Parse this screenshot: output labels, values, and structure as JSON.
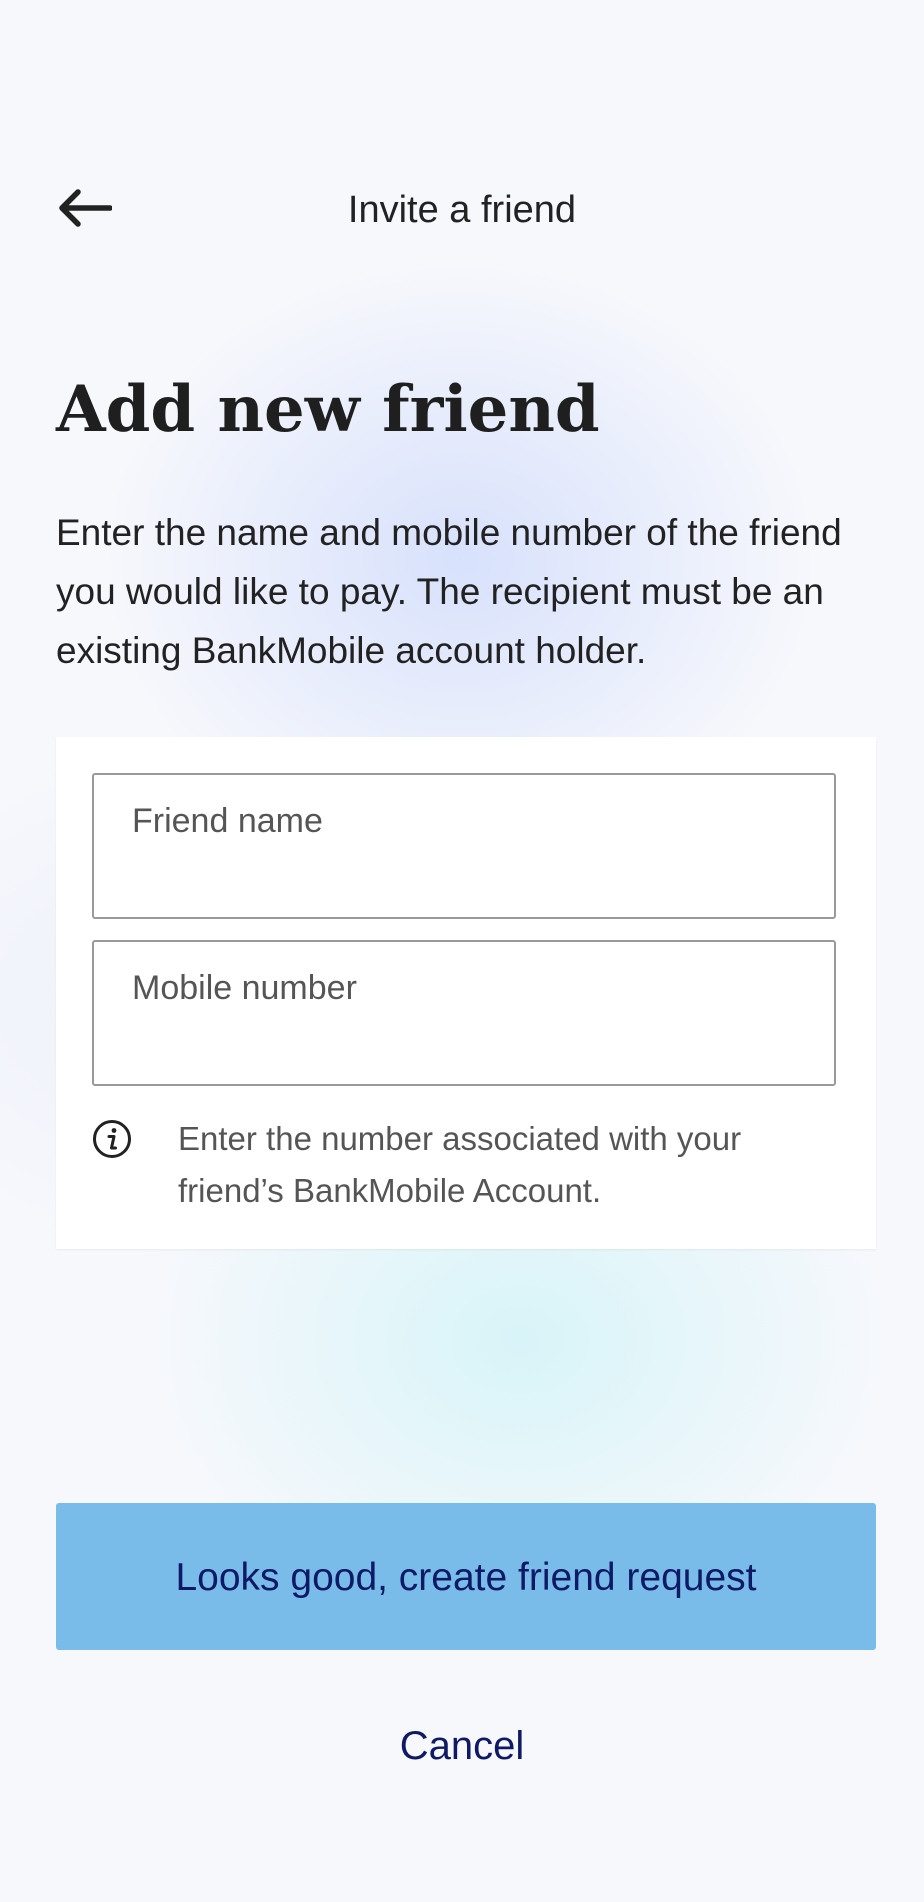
{
  "header": {
    "title": "Invite a friend",
    "back_icon": "arrow-left-icon"
  },
  "main": {
    "heading": "Add new friend",
    "description": "Enter the name and mobile number of the friend you would like to pay. The recipient must be an existing BankMobile account holder.",
    "form": {
      "friend_name": {
        "label": "Friend name",
        "value": ""
      },
      "mobile_number": {
        "label": "Mobile number",
        "value": ""
      },
      "hint": {
        "icon": "info-icon",
        "text": "Enter the number associated with your friend’s BankMobile Account."
      }
    }
  },
  "actions": {
    "primary_label": "Looks good, create friend request",
    "cancel_label": "Cancel"
  },
  "colors": {
    "primary_button_bg": "#7abce9",
    "primary_text": "#0e1a66",
    "body_text": "#222222",
    "secondary_text": "#555555",
    "field_border": "#9a9a9a"
  }
}
